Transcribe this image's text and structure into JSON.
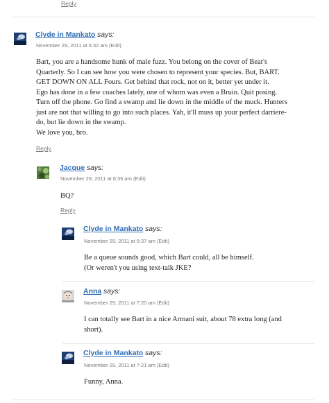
{
  "top": {
    "reply_label": "Reply"
  },
  "comments": [
    {
      "author": "Clyde in Mankato",
      "says": "says:",
      "date": "November 29, 2011 at 6:32 am",
      "edit": "(Edit)",
      "lines": [
        "Bart, you are a handsome hunk of male fuzz. You belong on the cover of Bear's",
        "Quarterly. So I can see how you were chosen to represent your species. But, BART.",
        "GET DOWN ON ALL Fours. Get behind that rock, not on it, better yet under it.",
        "Ego has done in a few coaches lately, one of whom was even a Bruin. Quit posing.",
        "Turn off the phone. Go find a swamp and lie down in the middle of the muck. Hunters",
        "just are not that willing to go into such places. Yah, it'll muss up your perfect darriere-",
        "do, but lie down in the swamp.",
        "We love you, bro."
      ],
      "reply_label": "Reply"
    },
    {
      "author": "Jacque",
      "says": "says:",
      "date": "November 29, 2011 at 6:35 am",
      "edit": "(Edit)",
      "lines": [
        "BQ?"
      ],
      "reply_label": "Reply"
    },
    {
      "author": "Clyde in Mankato",
      "says": "says:",
      "date": "November 29, 2011 at 6:37 am",
      "edit": "(Edit)",
      "lines": [
        "Be a queue sounds good, which Bart could, all be himself.",
        "(Or weren't you using text-talk JKE?"
      ]
    },
    {
      "author": "Anna",
      "says": "says:",
      "date": "November 29, 2011 at 7:20 am",
      "edit": "(Edit)",
      "lines": [
        "I can totally see Bart in a nice Armani suit, about 78 extra long (and",
        "short)."
      ]
    },
    {
      "author": "Clyde in Mankato",
      "says": "says:",
      "date": "November 29, 2011 at 7:21 am",
      "edit": "(Edit)",
      "lines": [
        "Funny, Anna."
      ]
    }
  ],
  "colors": {
    "link": "#2f6db5",
    "meta": "#777777",
    "divider": "#e4e4e4"
  }
}
